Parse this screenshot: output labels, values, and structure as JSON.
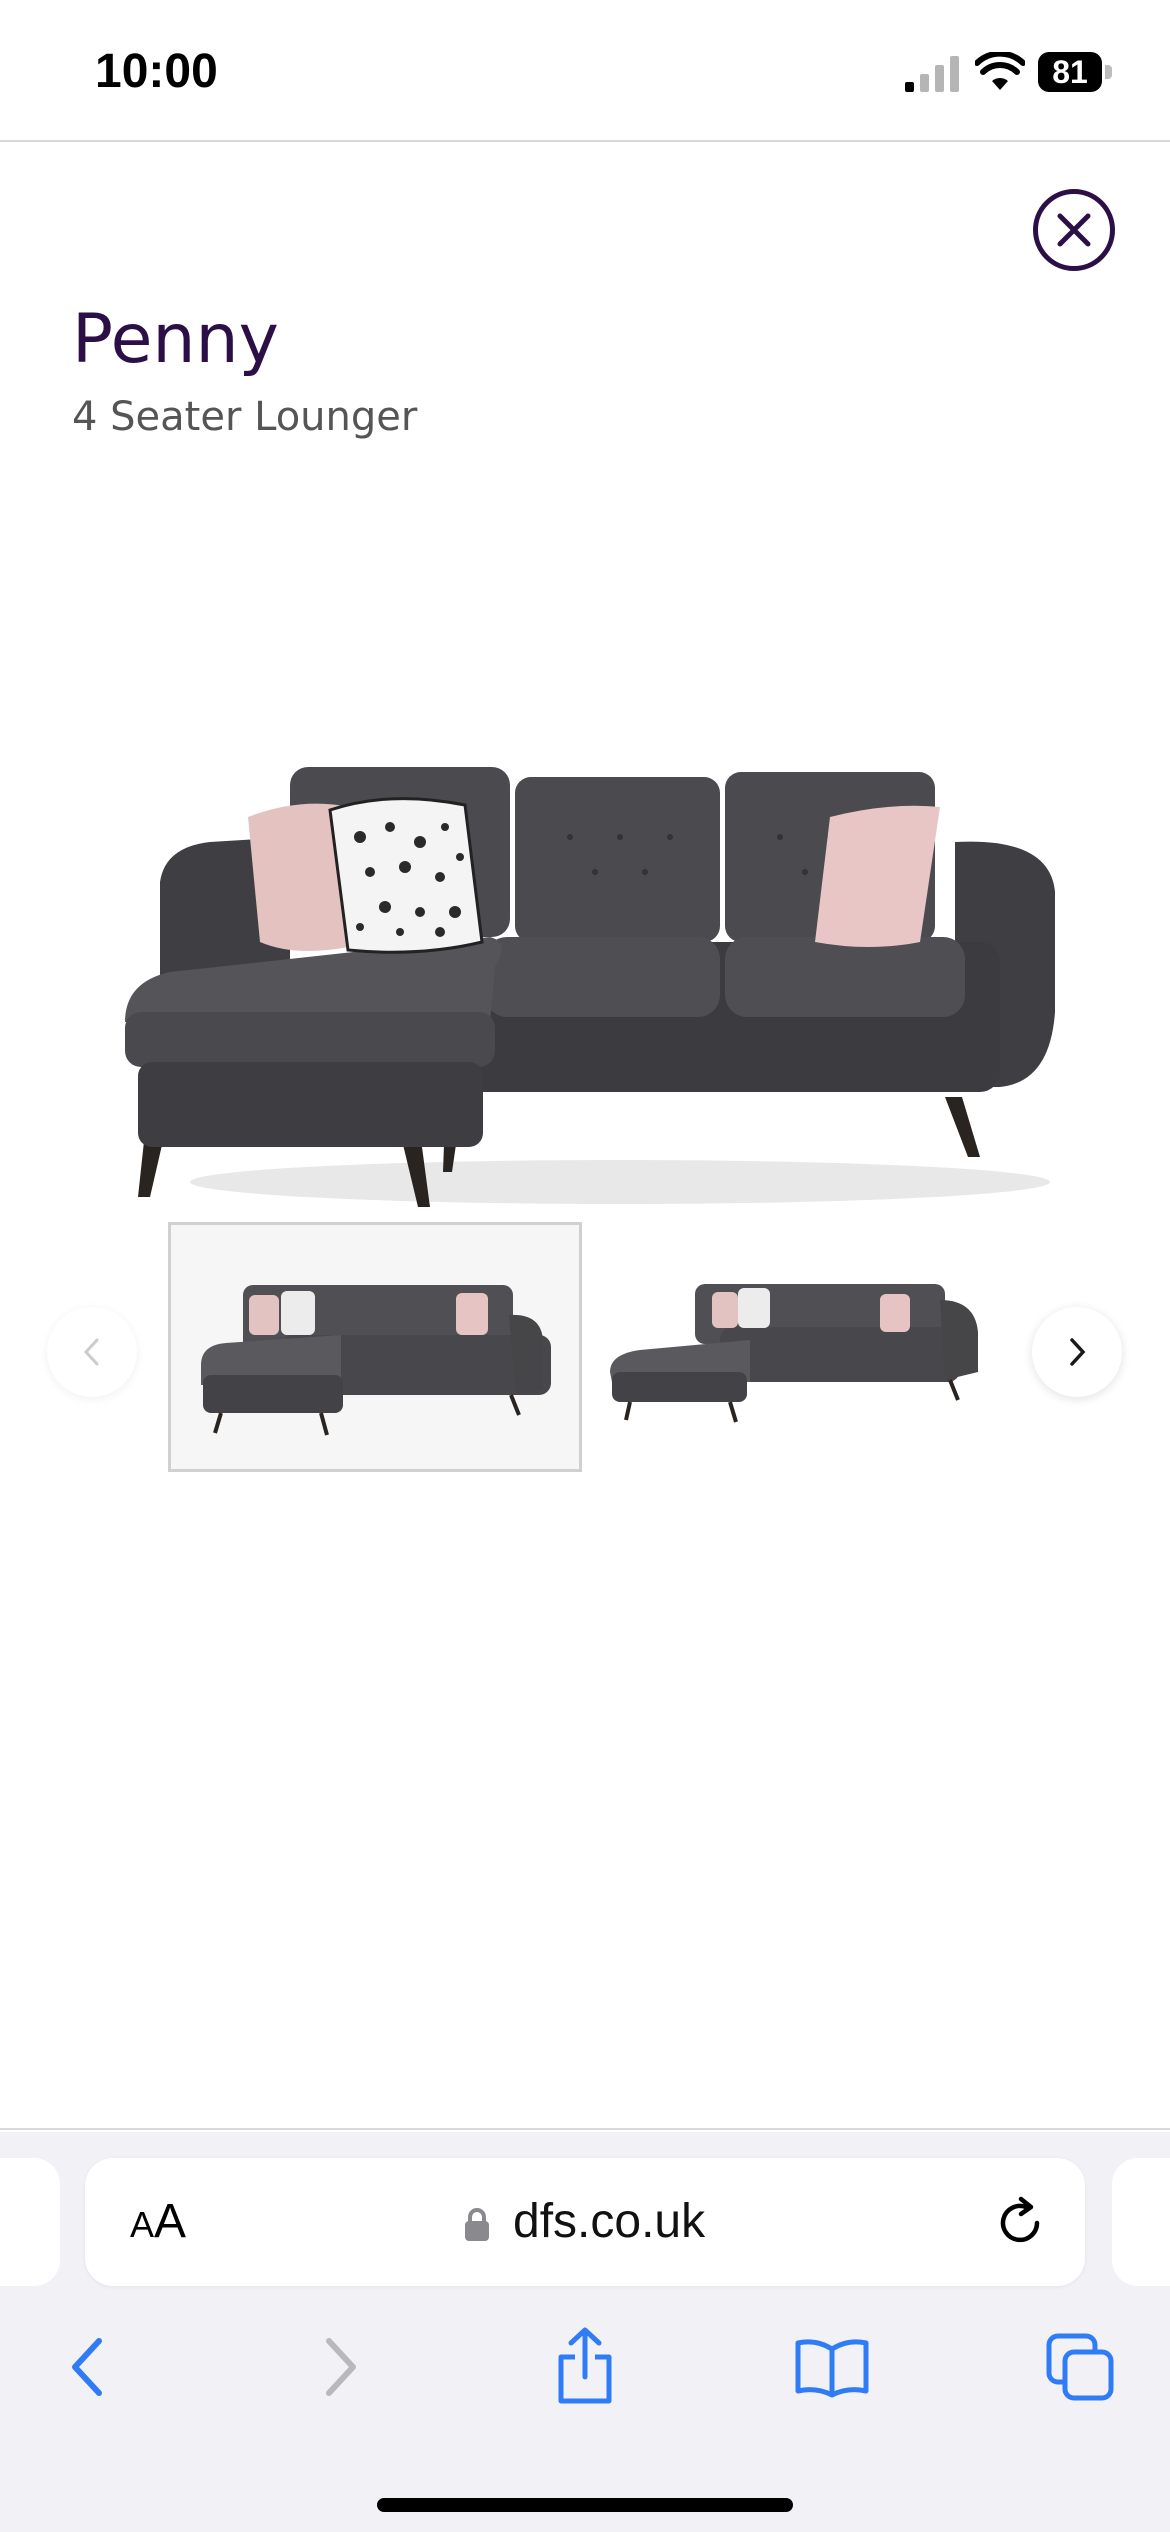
{
  "status_bar": {
    "time": "10:00",
    "battery": "81",
    "icons": [
      "signal-icon",
      "wifi-icon",
      "battery-icon"
    ]
  },
  "product": {
    "name": "Penny",
    "subtitle": "4 Seater Lounger"
  },
  "gallery": {
    "icons": [
      "chevron-left-icon",
      "chevron-right-icon"
    ],
    "selected_thumbnail": 1,
    "thumbnail_count": 2
  },
  "browser": {
    "text_size_label_small": "A",
    "text_size_label_large": "A",
    "url": "dfs.co.uk",
    "icons": [
      "lock-icon",
      "reload-icon",
      "back-icon",
      "forward-icon",
      "share-icon",
      "bookmarks-icon",
      "tabs-icon"
    ]
  },
  "colors": {
    "brand_purple": "#2c0f47",
    "ios_blue": "#2f7cf6",
    "sofa_grey": "#444448",
    "cushion_pink": "#e9c4c4"
  }
}
